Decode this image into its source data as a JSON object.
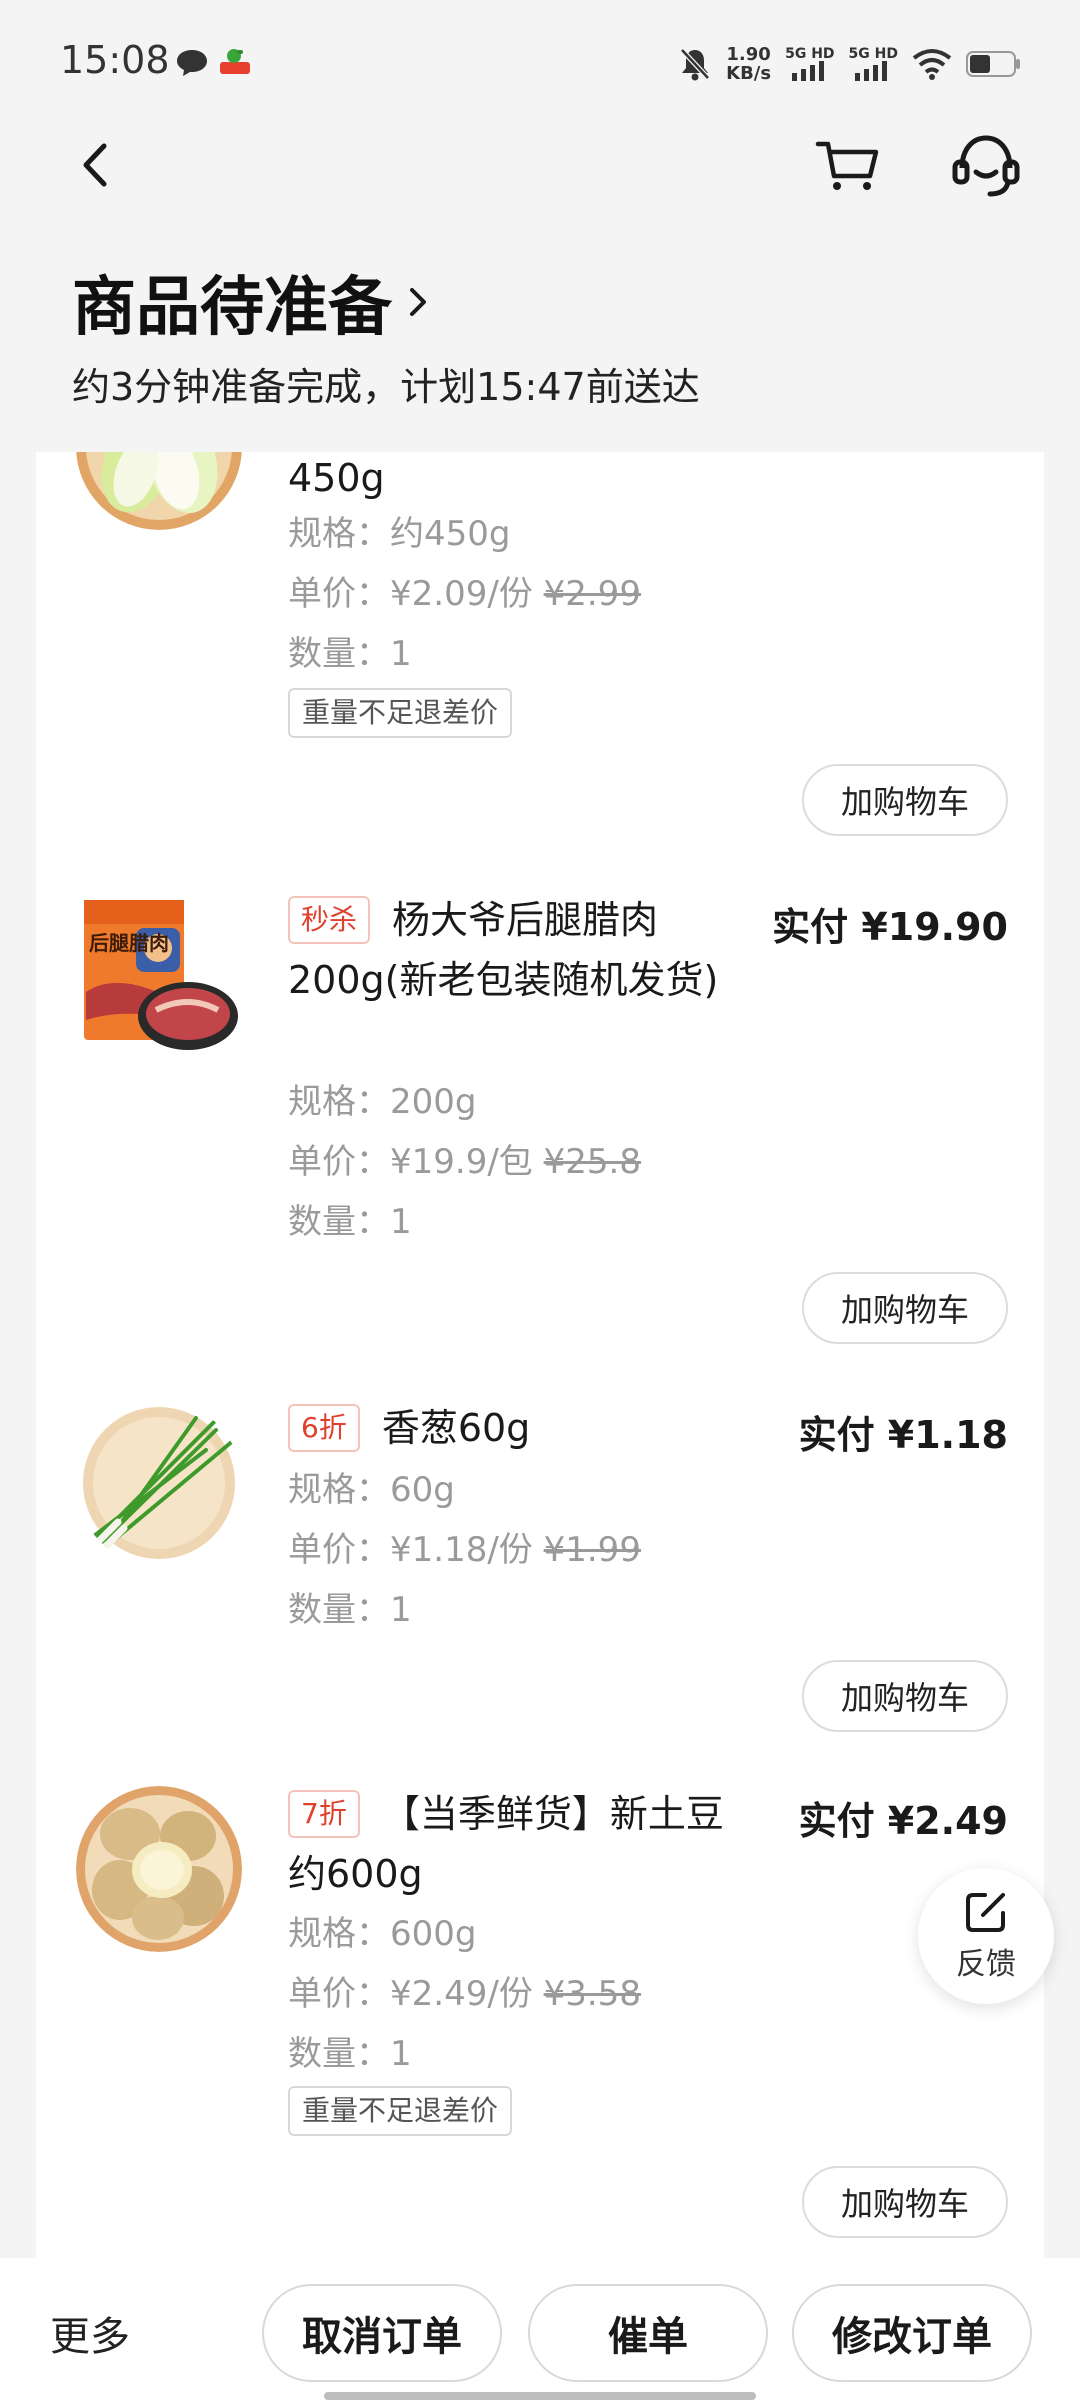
{
  "status_bar": {
    "time": "15:08",
    "net_speed_value": "1.90",
    "net_speed_unit": "KB/s",
    "signal1_label": "5G HD",
    "signal2_label": "5G HD"
  },
  "header": {
    "title": "商品待准备",
    "eta": "约3分钟准备完成，计划15:47前送达"
  },
  "items": [
    {
      "name": "450g",
      "spec": "规格：约450g",
      "unit_price_prefix": "单价：¥2.09/份 ",
      "original_price": "¥2.99",
      "quantity": "数量：1",
      "refund_tag": "重量不足退差价",
      "add_cart": "加购物车"
    },
    {
      "tag": "秒杀",
      "name": "杨大爷后腿腊肉200g(新老包装随机发货)",
      "paid": "实付 ¥19.90",
      "spec": "规格：200g",
      "unit_price_prefix": "单价：¥19.9/包 ",
      "original_price": "¥25.8",
      "quantity": "数量：1",
      "add_cart": "加购物车"
    },
    {
      "tag": "6折",
      "name": "香葱60g",
      "paid": "实付 ¥1.18",
      "spec": "规格：60g",
      "unit_price_prefix": "单价：¥1.18/份 ",
      "original_price": "¥1.99",
      "quantity": "数量：1",
      "add_cart": "加购物车"
    },
    {
      "tag": "7折",
      "name": "【当季鲜货】新土豆约600g",
      "paid": "实付 ¥2.49",
      "spec": "规格：600g",
      "unit_price_prefix": "单价：¥2.49/份 ",
      "original_price": "¥3.58",
      "quantity": "数量：1",
      "refund_tag": "重量不足退差价",
      "add_cart": "加购物车"
    }
  ],
  "product_image_text": "后腿腊肉",
  "feedback_label": "反馈",
  "bottom_bar": {
    "more": "更多",
    "cancel": "取消订单",
    "urge": "催单",
    "modify": "修改订单"
  }
}
